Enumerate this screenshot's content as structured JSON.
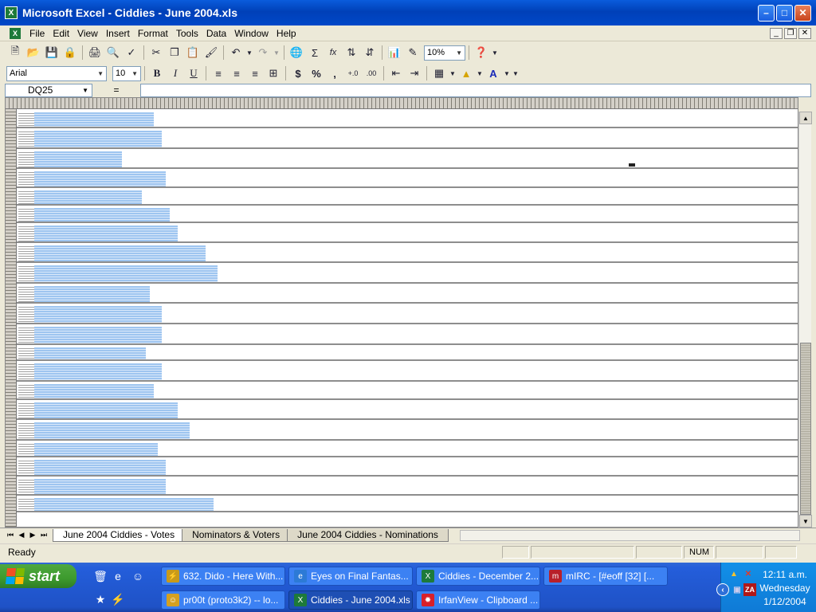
{
  "window": {
    "title": "Microsoft Excel - Ciddies - June 2004.xls",
    "app_icon": "excel-icon"
  },
  "menu": [
    "File",
    "Edit",
    "View",
    "Insert",
    "Format",
    "Tools",
    "Data",
    "Window",
    "Help"
  ],
  "toolbar": {
    "zoom": "10%",
    "font_name": "Arial",
    "font_size": "10",
    "bold": "B",
    "italic": "I",
    "underline": "U",
    "currency": "$",
    "percent": "%",
    "comma": ",",
    "autosum": "Σ",
    "function": "fx"
  },
  "formula_bar": {
    "name_box": "DQ25",
    "equals": "=",
    "formula": ""
  },
  "sheet_tabs": [
    {
      "label": "June 2004 Ciddies - Votes",
      "active": true
    },
    {
      "label": "Nominators & Voters",
      "active": false
    },
    {
      "label": "June 2004 Ciddies - Nominations",
      "active": false
    }
  ],
  "status": {
    "text": "Ready",
    "num": "NUM"
  },
  "taskbar": {
    "start_label": "start",
    "tasks_row1": [
      {
        "label": "632. Dido - Here With...",
        "icon": "winamp-icon",
        "active": false
      },
      {
        "label": "Eyes on Final Fantas...",
        "icon": "ie-icon",
        "active": false
      },
      {
        "label": "Ciddies - December 2...",
        "icon": "excel-icon",
        "active": false
      },
      {
        "label": "mIRC - [#eoff [32] [...",
        "icon": "mirc-icon",
        "active": false
      }
    ],
    "tasks_row2": [
      {
        "label": "pr00t (proto3k2) -- lo...",
        "icon": "messenger-icon",
        "active": false
      },
      {
        "label": "Ciddies - June 2004.xls",
        "icon": "excel-icon",
        "active": true
      },
      {
        "label": "IrfanView - Clipboard ...",
        "icon": "irfanview-icon",
        "active": false
      }
    ],
    "clock": {
      "time": "12:11 a.m.",
      "day": "Wednesday",
      "date": "1/12/2004"
    }
  }
}
